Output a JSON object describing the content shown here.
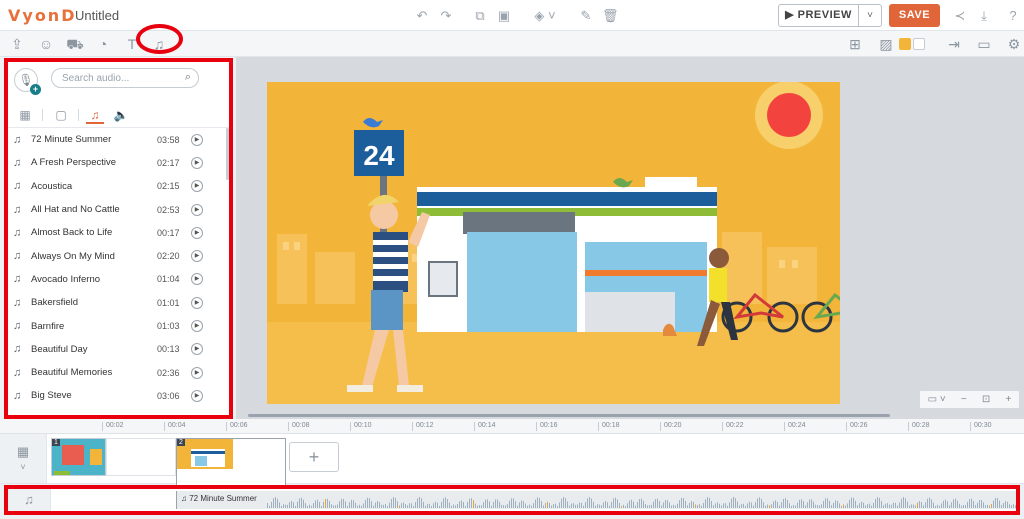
{
  "app": {
    "logo": "VyonD",
    "title": "Untitled"
  },
  "header": {
    "preview_label": "▶ PREVIEW",
    "save_label": "SAVE"
  },
  "audio_panel": {
    "search_placeholder": "Search audio...",
    "tracks": [
      {
        "name": "72 Minute Summer",
        "duration": "03:58"
      },
      {
        "name": "A Fresh Perspective",
        "duration": "02:17"
      },
      {
        "name": "Acoustica",
        "duration": "02:15"
      },
      {
        "name": "All Hat and No Cattle",
        "duration": "02:53"
      },
      {
        "name": "Almost Back to Life",
        "duration": "00:17"
      },
      {
        "name": "Always On My Mind",
        "duration": "02:20"
      },
      {
        "name": "Avocado Inferno",
        "duration": "01:04"
      },
      {
        "name": "Bakersfield",
        "duration": "01:01"
      },
      {
        "name": "Barnfire",
        "duration": "01:03"
      },
      {
        "name": "Beautiful Day",
        "duration": "00:13"
      },
      {
        "name": "Beautiful Memories",
        "duration": "02:36"
      },
      {
        "name": "Big Steve",
        "duration": "03:06"
      }
    ]
  },
  "scene": {
    "sign_number": "24"
  },
  "timeline": {
    "ticks": [
      "00:02",
      "00:04",
      "00:06",
      "00:08",
      "00:10",
      "00:12",
      "00:14",
      "00:16",
      "00:18",
      "00:20",
      "00:22",
      "00:24",
      "00:26",
      "00:28",
      "00:30"
    ],
    "scenes": [
      {
        "number": "1"
      },
      {
        "number": "2"
      }
    ],
    "add_scene": "+",
    "audio_clip": "72 Minute Summer"
  },
  "colors": {
    "accent": "#e0663a",
    "annotation": "#e8000f",
    "scene_bg": "#f2b53a",
    "teal": "#177e8a"
  }
}
